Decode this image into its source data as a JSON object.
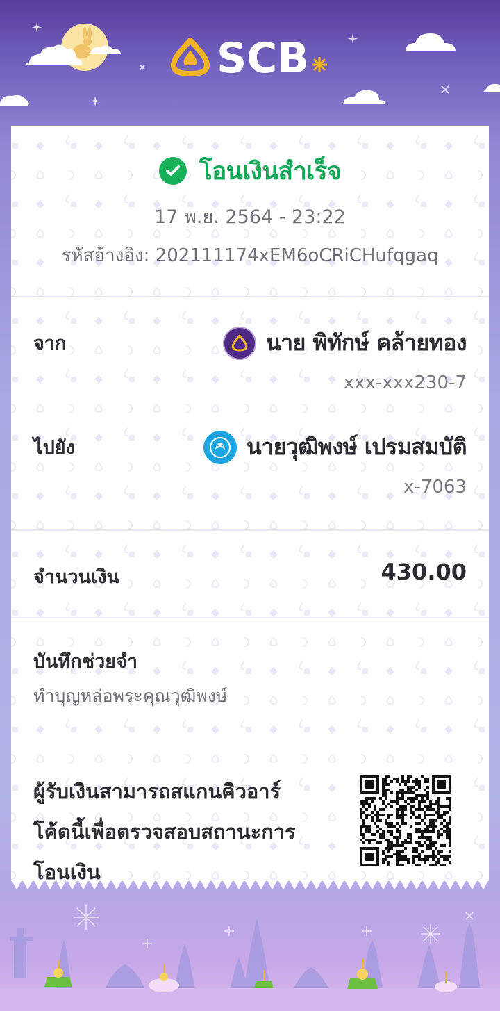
{
  "brand": {
    "name": "SCB"
  },
  "status": {
    "text": "โอนเงินสำเร็จ",
    "color": "#15b25a"
  },
  "datetime": "17 พ.ย. 2564 - 23:22",
  "reference": {
    "label": "รหัสอ้างอิง:",
    "value": "202111174xEM6oCRiCHufqgaq"
  },
  "from": {
    "label": "จาก",
    "name": "นาย พิทักษ์ คล้ายทอง",
    "account": "xxx-xxx230-7",
    "bank_icon": "scb-bank-icon"
  },
  "to": {
    "label": "ไปยัง",
    "name": "นายวุฒิพงษ์ เปรมสมบัติ",
    "account": "x-7063",
    "bank_icon": "ktb-bank-icon"
  },
  "amount": {
    "label": "จำนวนเงิน",
    "value": "430.00"
  },
  "memo": {
    "label": "บันทึกช่วยจำ",
    "value": "ทำบุญหล่อพระคุณวุฒิพงษ์"
  },
  "qr": {
    "lines": [
      "ผู้รับเงินสามารถสแกนคิวอาร์",
      "โค้ดนี้เพื่อตรวจสอบสถานะการ",
      "โอนเงิน"
    ]
  },
  "colors": {
    "scb_purple": "#4e2a84",
    "gold": "#f2b427",
    "success_green": "#15b25a",
    "ktb_blue": "#1ba5e1"
  }
}
